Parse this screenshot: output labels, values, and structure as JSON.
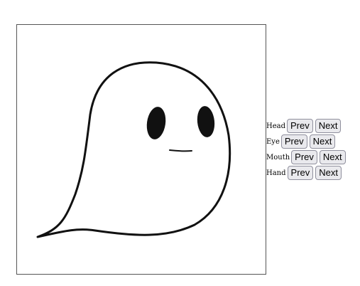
{
  "controls": [
    {
      "label": "Head",
      "prev_label": "Prev",
      "next_label": "Next"
    },
    {
      "label": "Eye",
      "prev_label": "Prev",
      "next_label": "Next"
    },
    {
      "label": "Mouth",
      "prev_label": "Prev",
      "next_label": "Next"
    },
    {
      "label": "Hand",
      "prev_label": "Prev",
      "next_label": "Next"
    }
  ],
  "colors": {
    "stroke": "#111111",
    "button_bg": "#e9e9ed"
  }
}
